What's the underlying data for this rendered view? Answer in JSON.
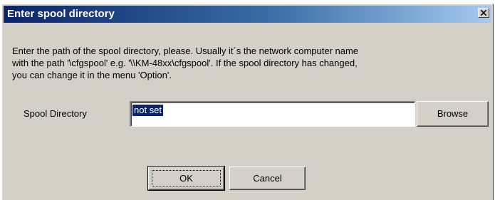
{
  "window": {
    "title": "Enter spool directory",
    "close_icon": "close-icon"
  },
  "message": {
    "lines": [
      "Enter the path of the spool directory, please. Usually it´s the network computer name",
      "with the path '\\cfgspool' e.g. '\\\\KM-48xx\\cfgspool'. If the spool directory has changed,",
      "you can change it in the menu 'Option'."
    ]
  },
  "form": {
    "spool_label": "Spool Directory",
    "spool_value": "not set",
    "browse_label": "Browse"
  },
  "buttons": {
    "ok_label": "OK",
    "cancel_label": "Cancel"
  },
  "colors": {
    "titlebar_start": "#0a246a",
    "titlebar_end": "#a6caf0",
    "dialog_bg": "#d4d0c8",
    "selection": "#0a246a"
  }
}
